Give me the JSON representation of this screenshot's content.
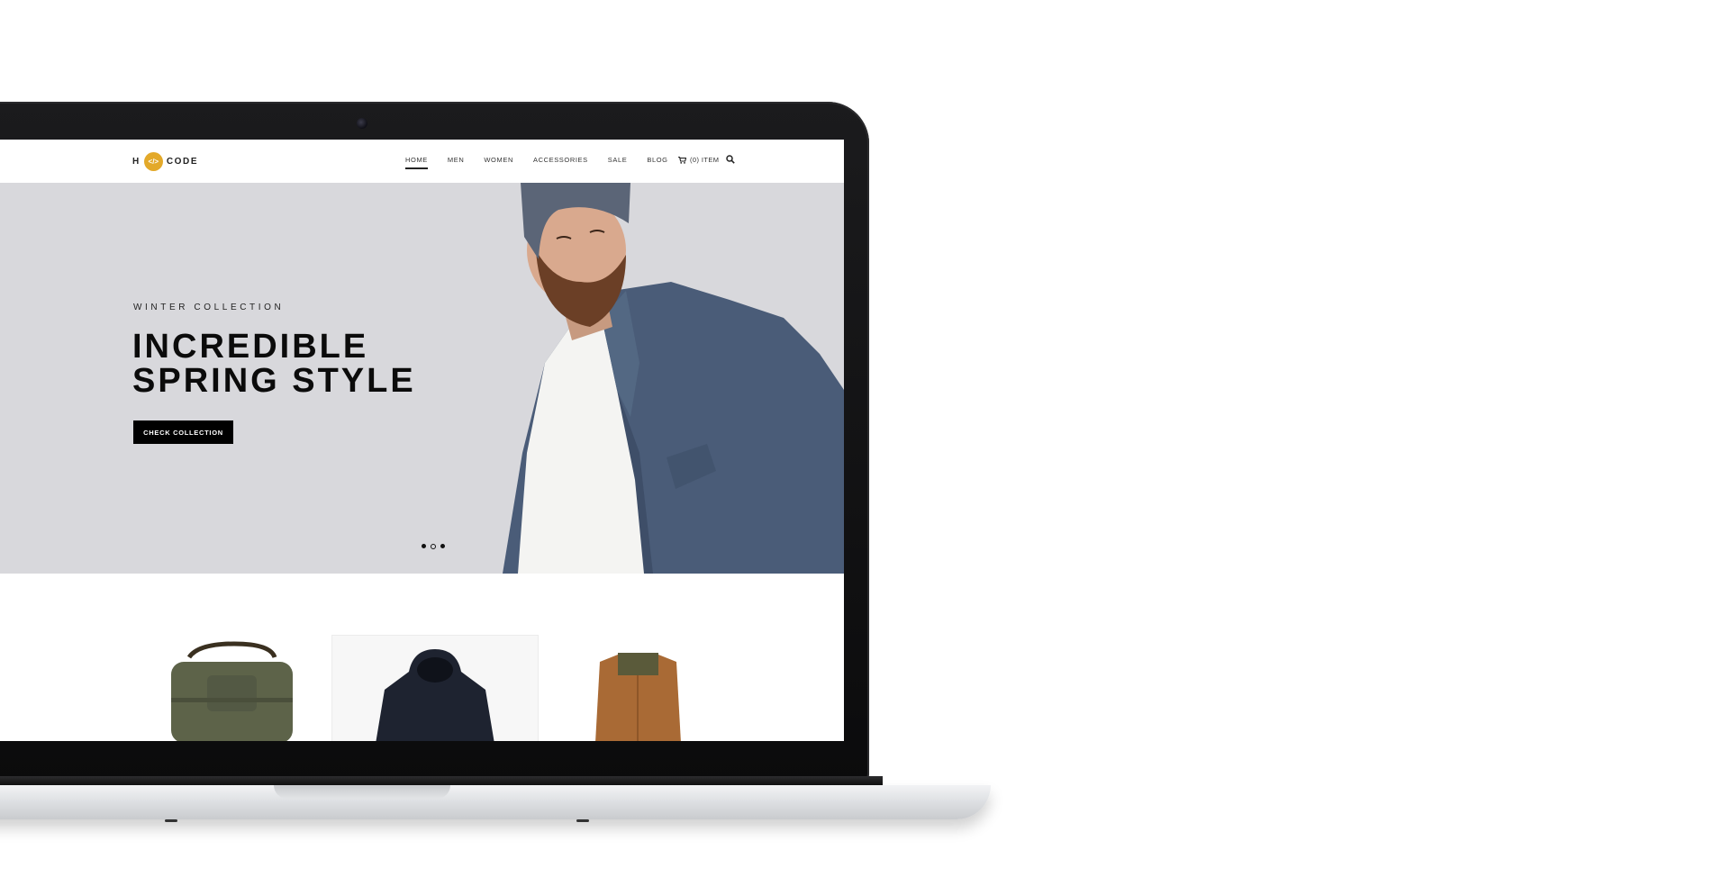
{
  "header": {
    "logo_left": "H",
    "logo_badge": "</>",
    "logo_right": "CODE",
    "nav": [
      {
        "label": "HOME",
        "active": true
      },
      {
        "label": "MEN",
        "active": false
      },
      {
        "label": "WOMEN",
        "active": false
      },
      {
        "label": "ACCESSORIES",
        "active": false
      },
      {
        "label": "SALE",
        "active": false
      },
      {
        "label": "BLOG",
        "active": false
      }
    ],
    "cart_label": "(0) ITEM",
    "cart_icon": "cart-icon",
    "search_icon": "search-icon"
  },
  "hero": {
    "eyebrow": "WINTER COLLECTION",
    "title_line1": "INCREDIBLE",
    "title_line2": "SPRING STYLE",
    "button_label": "CHECK COLLECTION",
    "slides": 3,
    "active_slide": 2
  },
  "products": [
    {
      "name": "bag",
      "highlight": false
    },
    {
      "name": "hoodie",
      "highlight": true
    },
    {
      "name": "vest",
      "highlight": false
    }
  ],
  "colors": {
    "accent": "#e3a92a",
    "hero_bg": "#d8d8dc",
    "button_bg": "#000000"
  }
}
